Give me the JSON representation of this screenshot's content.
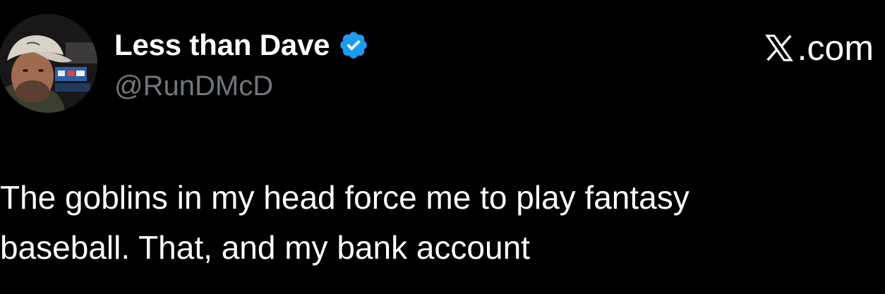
{
  "author": {
    "display_name": "Less than Dave",
    "handle": "@RunDMcD",
    "verified": true
  },
  "brand": {
    "text": ".com",
    "icon": "x-logo-icon"
  },
  "tweet": {
    "text": "The goblins in my head force me to play fantasy\nbaseball. That, and my bank account"
  },
  "colors": {
    "background": "#000000",
    "name": "#ffffff",
    "handle": "#71767b",
    "verified_badge": "#1d9bf0",
    "body_text": "#ffffff"
  }
}
